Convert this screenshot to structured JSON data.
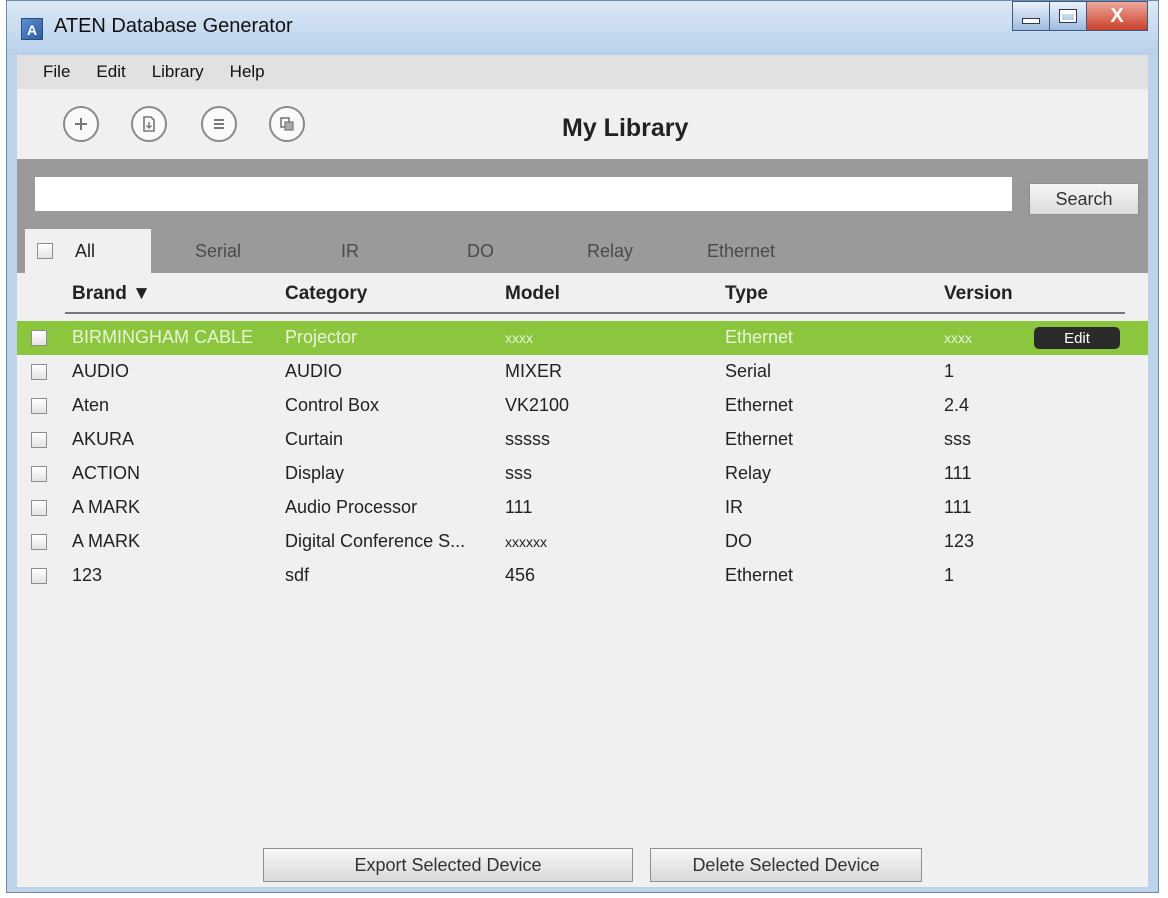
{
  "window": {
    "title": "ATEN Database Generator",
    "close_glyph": "X"
  },
  "menu": [
    "File",
    "Edit",
    "Library",
    "Help"
  ],
  "toolbar": {
    "title": "My Library",
    "icons": [
      "add-icon",
      "import-icon",
      "list-icon",
      "copy-icon"
    ]
  },
  "search": {
    "value": "",
    "button_label": "Search"
  },
  "tabs": [
    "All",
    "Serial",
    "IR",
    "DO",
    "Relay",
    "Ethernet"
  ],
  "columns": {
    "brand": "Brand ▼",
    "category": "Category",
    "model": "Model",
    "type": "Type",
    "version": "Version"
  },
  "rows": [
    {
      "brand": "BIRMINGHAM CABLE",
      "category": "Projector",
      "model": "xxxx",
      "type": "Ethernet",
      "version": "xxxx",
      "selected": true,
      "edit": "Edit"
    },
    {
      "brand": "AUDIO",
      "category": "AUDIO",
      "model": "MIXER",
      "type": "Serial",
      "version": "1"
    },
    {
      "brand": "Aten",
      "category": "Control Box",
      "model": "VK2100",
      "type": "Ethernet",
      "version": "2.4"
    },
    {
      "brand": "AKURA",
      "category": "Curtain",
      "model": "sssss",
      "type": "Ethernet",
      "version": "sss"
    },
    {
      "brand": "ACTION",
      "category": "Display",
      "model": "sss",
      "type": "Relay",
      "version": "111"
    },
    {
      "brand": "A MARK",
      "category": "Audio Processor",
      "model": "111",
      "type": "IR",
      "version": "111"
    },
    {
      "brand": "A MARK",
      "category": "Digital Conference S...",
      "model": "xxxxxx",
      "type": "DO",
      "version": "123"
    },
    {
      "brand": "123",
      "category": "sdf",
      "model": "456",
      "type": "Ethernet",
      "version": "1"
    }
  ],
  "actions": {
    "export": "Export Selected Device",
    "delete": "Delete Selected Device"
  },
  "colors": {
    "selected_row": "#8cc63f",
    "filter_bar": "#9a9a9a"
  }
}
